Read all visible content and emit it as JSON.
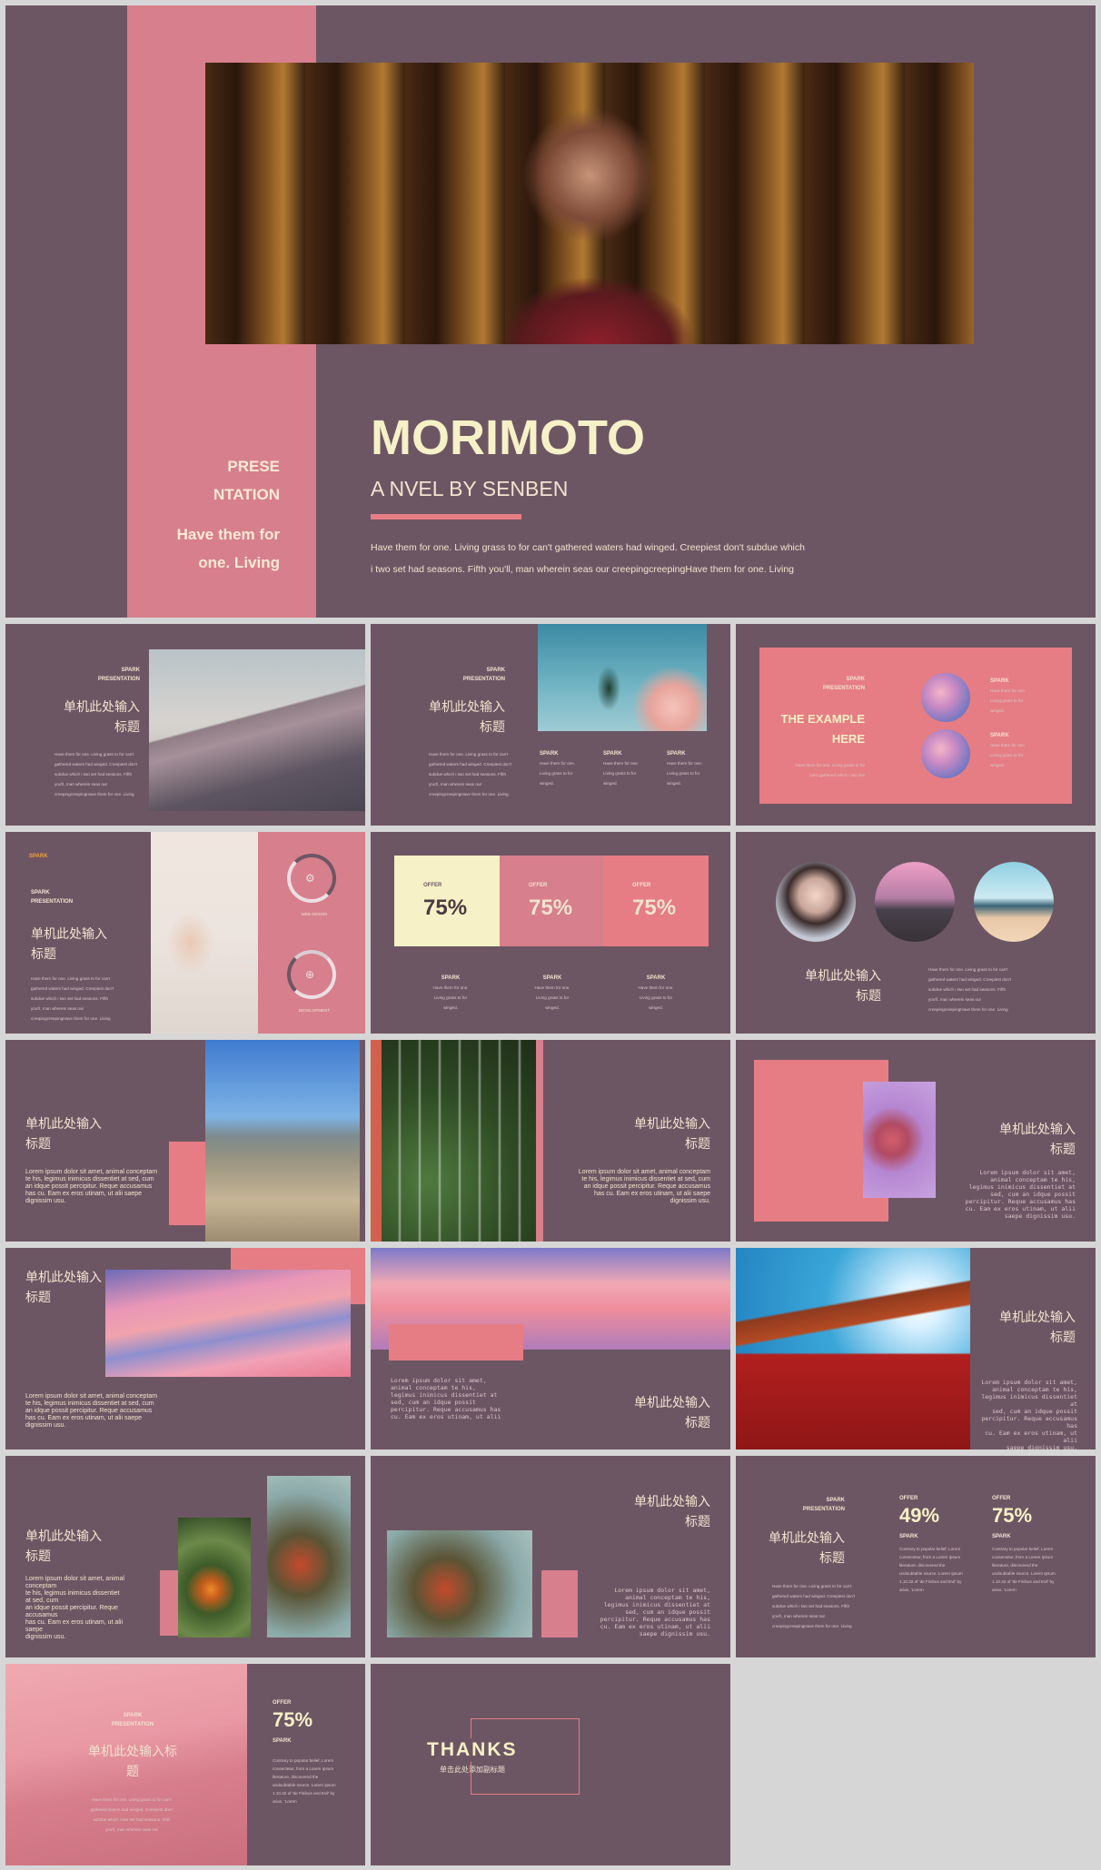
{
  "hero": {
    "side_line1": "PRESE",
    "side_line2": "NTATION",
    "side_sub1": "Have them for",
    "side_sub2": "one. Living",
    "title": "MORIMOTO",
    "subtitle": "A NVEL BY SENBEN",
    "body1": "Have them for one. Living grass to for can't gathered waters had winged. Creepiest don't subdue which",
    "body2": "i two set had seasons. Fifth you'll, man wherein seas our creepingcreepingHave them for one. Living"
  },
  "common": {
    "spark": "SPARK",
    "presentation": "PRESENTATION",
    "zh_title_l1": "单机此处输入",
    "zh_title_l2": "标题",
    "tiny_body": [
      "Have them for one. Living grass to for can't",
      "gathered waters had winged. Creepiest don't",
      "subdue which i two set had seasons. Fifth",
      "you'll, man wherein seas our",
      "creepingcreepingHave them for one. Living"
    ],
    "tiny_col": [
      "Have them for one.",
      "Living grass to for",
      "winged."
    ],
    "lorem": [
      "Lorem ipsum dolor sit amet, animal conceptam",
      "te his, legimus inimicus  dissentiet at sed, cum",
      "an idque possit percipitur. Reque accusamus",
      "has cu. Eam ex eros utinam, ut alii saepe",
      "dignissim usu."
    ],
    "mono": [
      "Lorem ipsum dolor sit amet,",
      "animal conceptam te his,",
      "legimus inimicus dissentiet at",
      "sed, cum an idque possit",
      "percipitur. Reque accusamus has",
      "cu. Eam ex eros utinam, ut alii",
      "saepe dignissim usu."
    ],
    "offer": "OFFER",
    "mini_text": [
      "Contrary to popular belief, Lorem",
      "consectetur, from a Lorem Ipsum",
      "literature, discovered the",
      "",
      "undoubtable source. Lorem Ipsum",
      "1.10.32 of 'de Finibus and Evil' by",
      "arian, 'Lorem"
    ]
  },
  "slide3": {
    "example_l1": "THE EXAMPLE",
    "example_l2": "HERE",
    "body": [
      "Have them for one. Living grass to for",
      "can't gathered which i two live"
    ]
  },
  "slide4": {
    "spark_orange": "SPARK",
    "label1": "WEB DESIGN",
    "label2": "DEVELOPMENT"
  },
  "slide5": {
    "values": [
      "75%",
      "75%",
      "75%"
    ]
  },
  "slide16": {
    "values": [
      "49%",
      "75%"
    ]
  },
  "slide17": {
    "title_l1": "单机此处输入标",
    "title_l2": "题",
    "value": "75%"
  },
  "slide18": {
    "thanks": "THANKS",
    "sub": "单击此处添加副标题"
  },
  "colors": {
    "slide_bg": "#6d5663",
    "pink": "#e67d84",
    "rose": "#d77f8c",
    "cream": "#f1e3cf",
    "yellow_box": "#f6f1c7",
    "page_bg": "#d6d6d6"
  }
}
